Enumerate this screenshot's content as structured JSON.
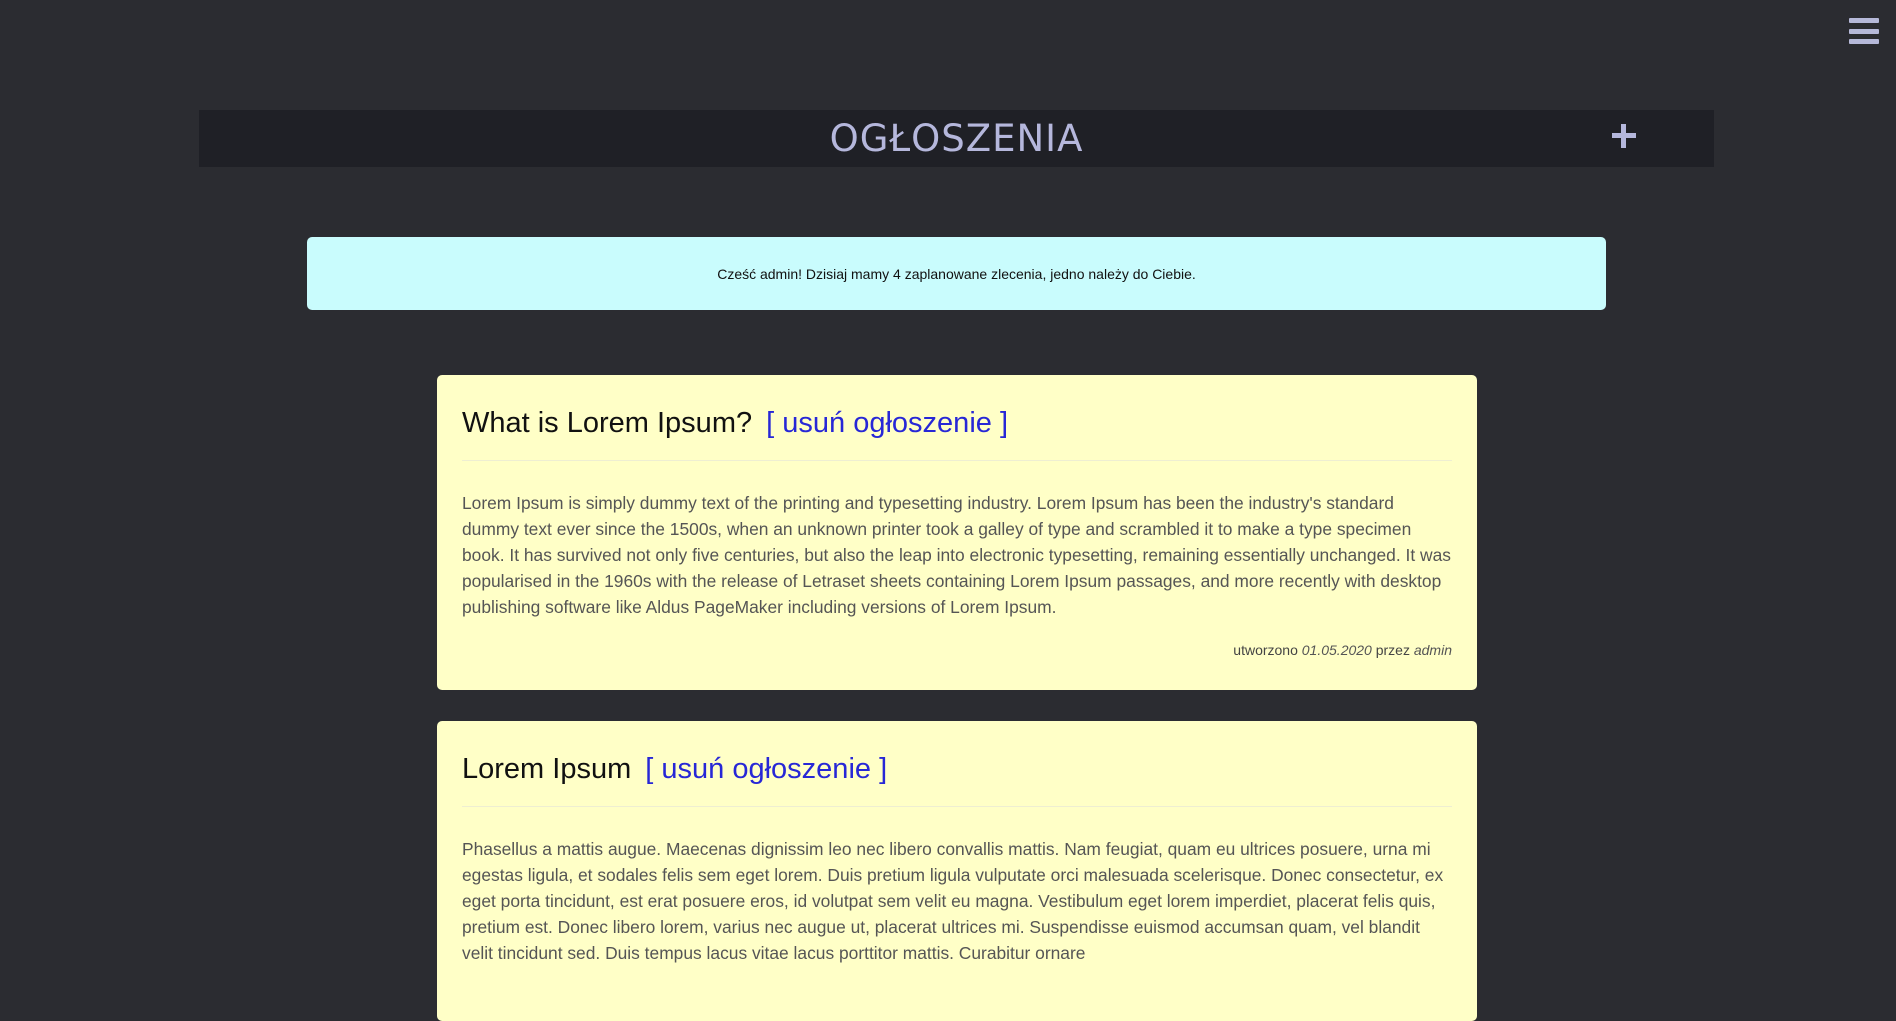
{
  "header": {
    "title": "OGŁOSZENIA",
    "add_icon": "plus-icon",
    "menu_icon": "hamburger-menu-icon"
  },
  "welcome": {
    "message": "Cześć admin! Dzisiaj mamy 4 zaplanowane zlecenia, jedno należy do Ciebie."
  },
  "posts": [
    {
      "title": "What is Lorem Ipsum?",
      "delete_label": "[ usuń ogłoszenie ]",
      "body": "Lorem Ipsum is simply dummy text of the printing and typesetting industry. Lorem Ipsum has been the industry's standard dummy text ever since the 1500s, when an unknown printer took a galley of type and scrambled it to make a type specimen book. It has survived not only five centuries, but also the leap into electronic typesetting, remaining essentially unchanged. It was popularised in the 1960s with the release of Letraset sheets containing Lorem Ipsum passages, and more recently with desktop publishing software like Aldus PageMaker including versions of Lorem Ipsum.",
      "meta_created": "utworzono",
      "date": "01.05.2020",
      "meta_by": "przez",
      "author": "admin"
    },
    {
      "title": "Lorem Ipsum",
      "delete_label": "[ usuń ogłoszenie ]",
      "body": "Phasellus a mattis augue. Maecenas dignissim leo nec libero convallis mattis. Nam feugiat, quam eu ultrices posuere, urna mi egestas ligula, et sodales felis sem eget lorem. Duis pretium ligula vulputate orci malesuada scelerisque. Donec consectetur, ex eget porta tincidunt, est erat posuere eros, id volutpat sem velit eu magna. Vestibulum eget lorem imperdiet, placerat felis quis, pretium est. Donec libero lorem, varius nec augue ut, placerat ultrices mi. Suspendisse euismod accumsan quam, vel blandit velit tincidunt sed. Duis tempus lacus vitae lacus porttitor mattis. Curabitur ornare"
    }
  ]
}
